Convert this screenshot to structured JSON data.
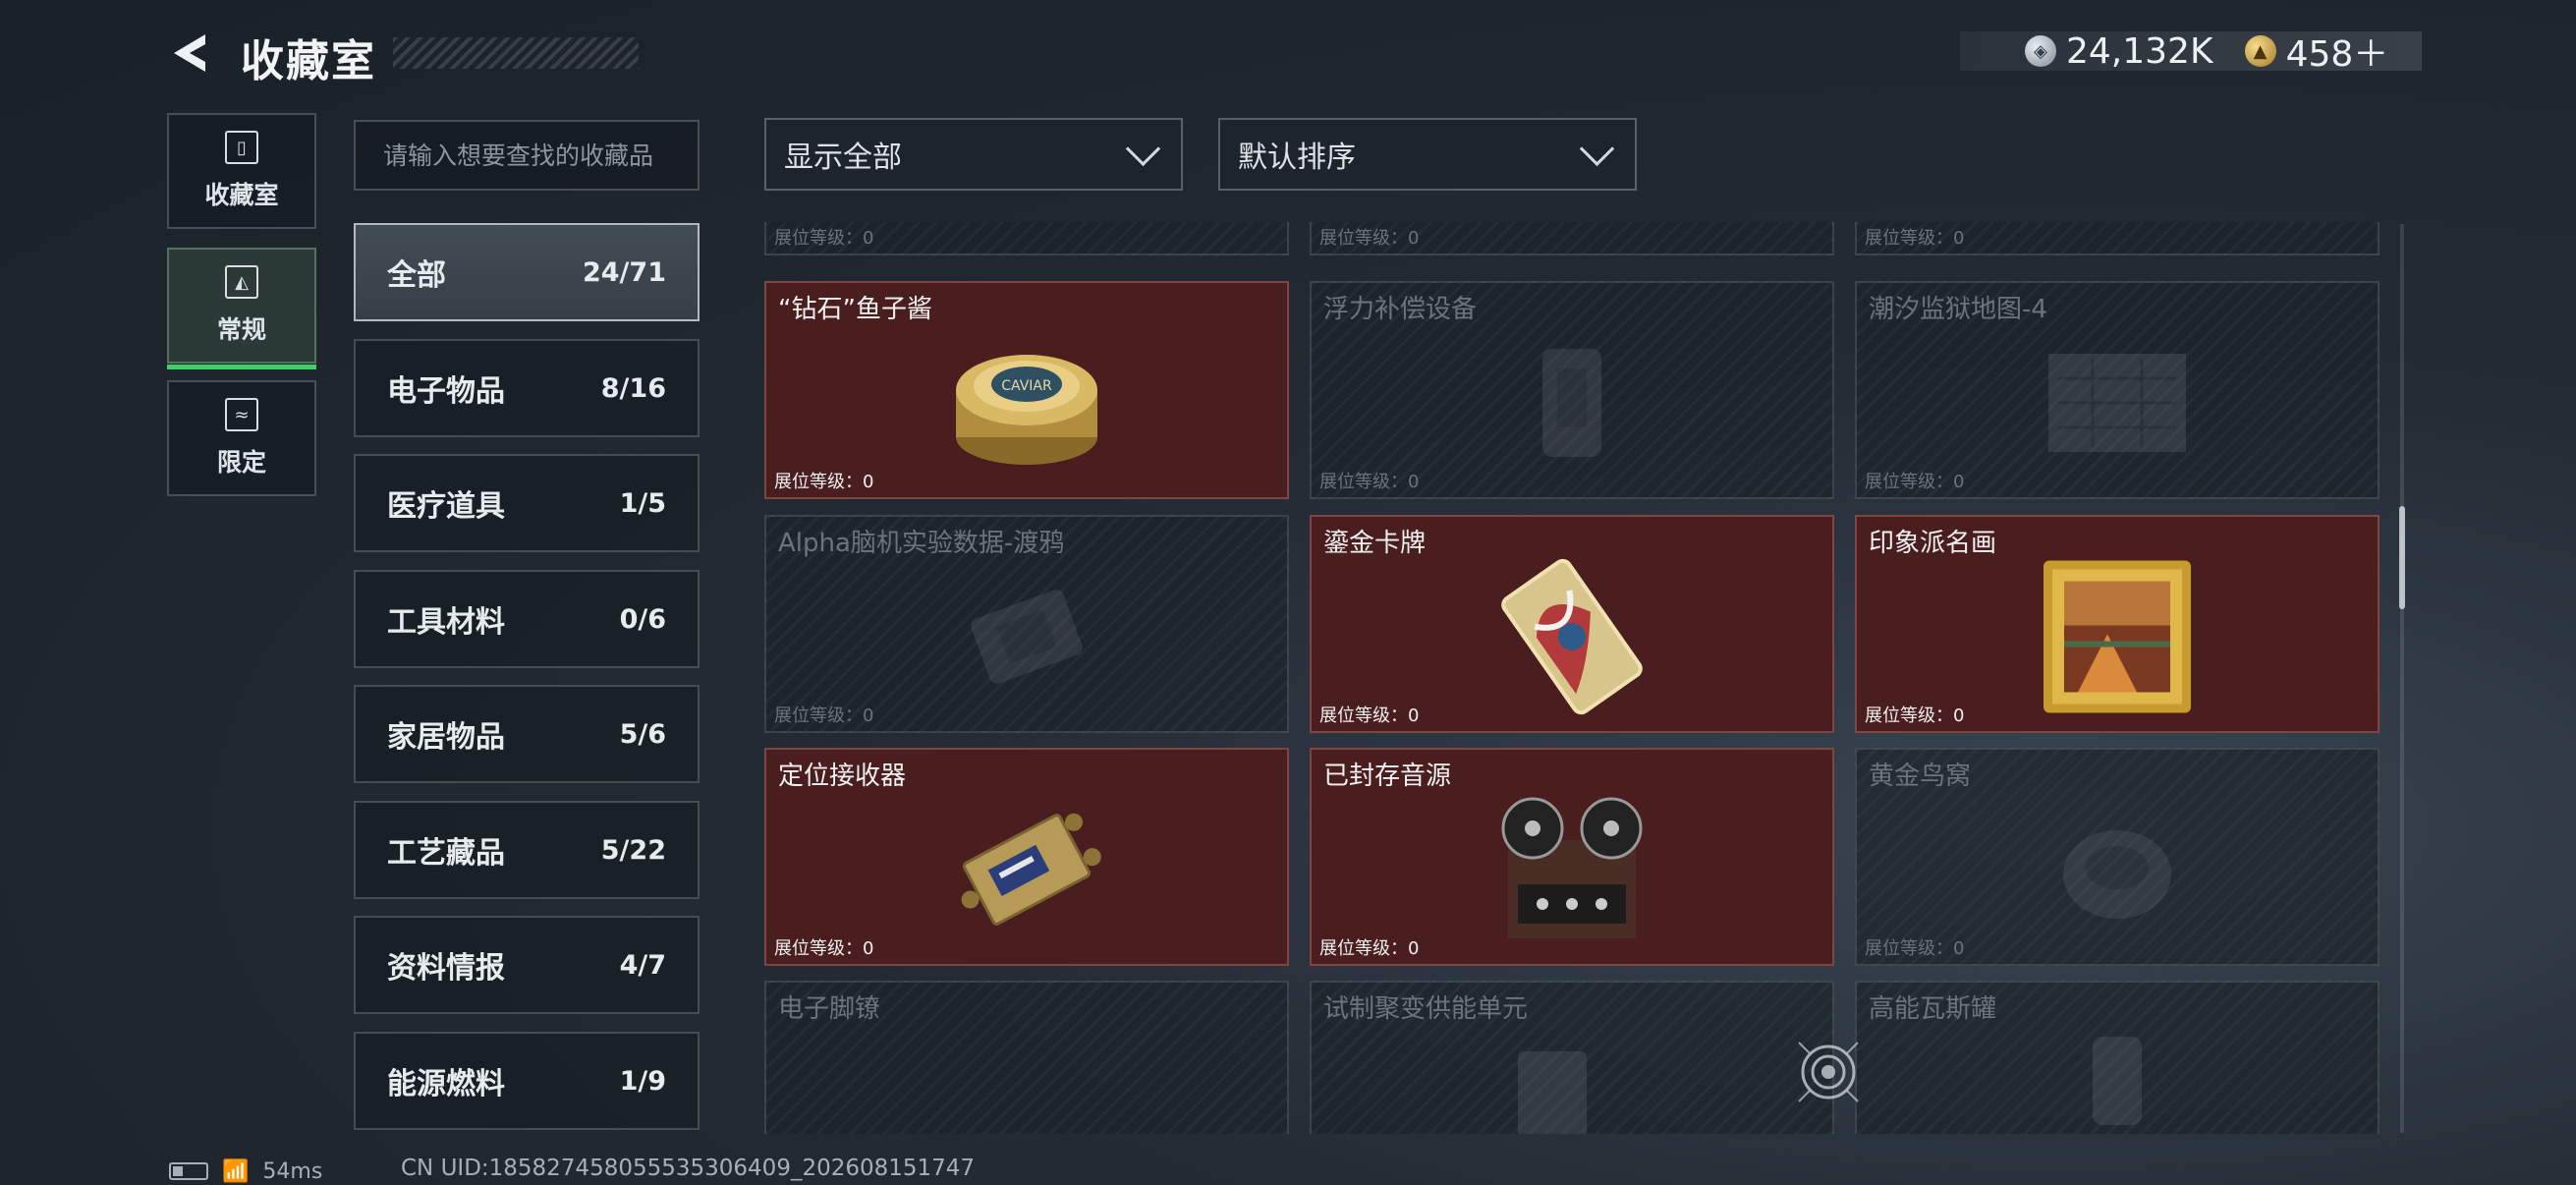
{
  "header": {
    "title": "收藏室",
    "currencies": [
      {
        "icon": "silver-coin-icon",
        "value": "24,132K"
      },
      {
        "icon": "gold-coin-icon",
        "value": "458＋"
      }
    ]
  },
  "nav": {
    "tabs": [
      {
        "label": "收藏室",
        "icon": "trash-can-icon",
        "active": false
      },
      {
        "label": "常规",
        "icon": "document-icon",
        "active": true
      },
      {
        "label": "限定",
        "icon": "map-icon",
        "active": false
      }
    ]
  },
  "search": {
    "placeholder": "请输入想要查找的收藏品"
  },
  "filters": {
    "display": "显示全部",
    "sort": "默认排序"
  },
  "categories": [
    {
      "name": "全部",
      "count": "24/71",
      "active": true
    },
    {
      "name": "电子物品",
      "count": "8/16"
    },
    {
      "name": "医疗道具",
      "count": "1/5"
    },
    {
      "name": "工具材料",
      "count": "0/6"
    },
    {
      "name": "家居物品",
      "count": "5/6"
    },
    {
      "name": "工艺藏品",
      "count": "5/22"
    },
    {
      "name": "资料情报",
      "count": "4/7"
    },
    {
      "name": "能源燃料",
      "count": "1/9"
    }
  ],
  "level_label": "展位等级：0",
  "items": [
    {
      "name": "",
      "owned": false
    },
    {
      "name": "",
      "owned": false
    },
    {
      "name": "",
      "owned": false
    },
    {
      "name": "“钻石”鱼子酱",
      "owned": true,
      "icon": "caviar-tin-icon"
    },
    {
      "name": "浮力补偿设备",
      "owned": false,
      "icon": "buoyancy-device-icon"
    },
    {
      "name": "潮汐监狱地图-4",
      "owned": false,
      "icon": "map-sheet-icon"
    },
    {
      "name": "Alpha脑机实验数据-渡鸦",
      "owned": false,
      "icon": "data-drive-icon"
    },
    {
      "name": "鎏金卡牌",
      "owned": true,
      "icon": "gilded-card-icon"
    },
    {
      "name": "印象派名画",
      "owned": true,
      "icon": "framed-painting-icon"
    },
    {
      "name": "定位接收器",
      "owned": true,
      "icon": "locator-receiver-icon"
    },
    {
      "name": "已封存音源",
      "owned": true,
      "icon": "reel-tape-recorder-icon"
    },
    {
      "name": "黄金鸟窝",
      "owned": false,
      "icon": "golden-nest-icon"
    },
    {
      "name": "电子脚镣",
      "owned": false,
      "icon": "ankle-monitor-icon"
    },
    {
      "name": "试制聚变供能单元",
      "owned": false,
      "icon": "fusion-cell-icon"
    },
    {
      "name": "高能瓦斯罐",
      "owned": false,
      "icon": "gas-canister-icon"
    }
  ],
  "status": {
    "ping": "54ms",
    "uid": "CN UID:185827458055535306409_202608151747"
  }
}
